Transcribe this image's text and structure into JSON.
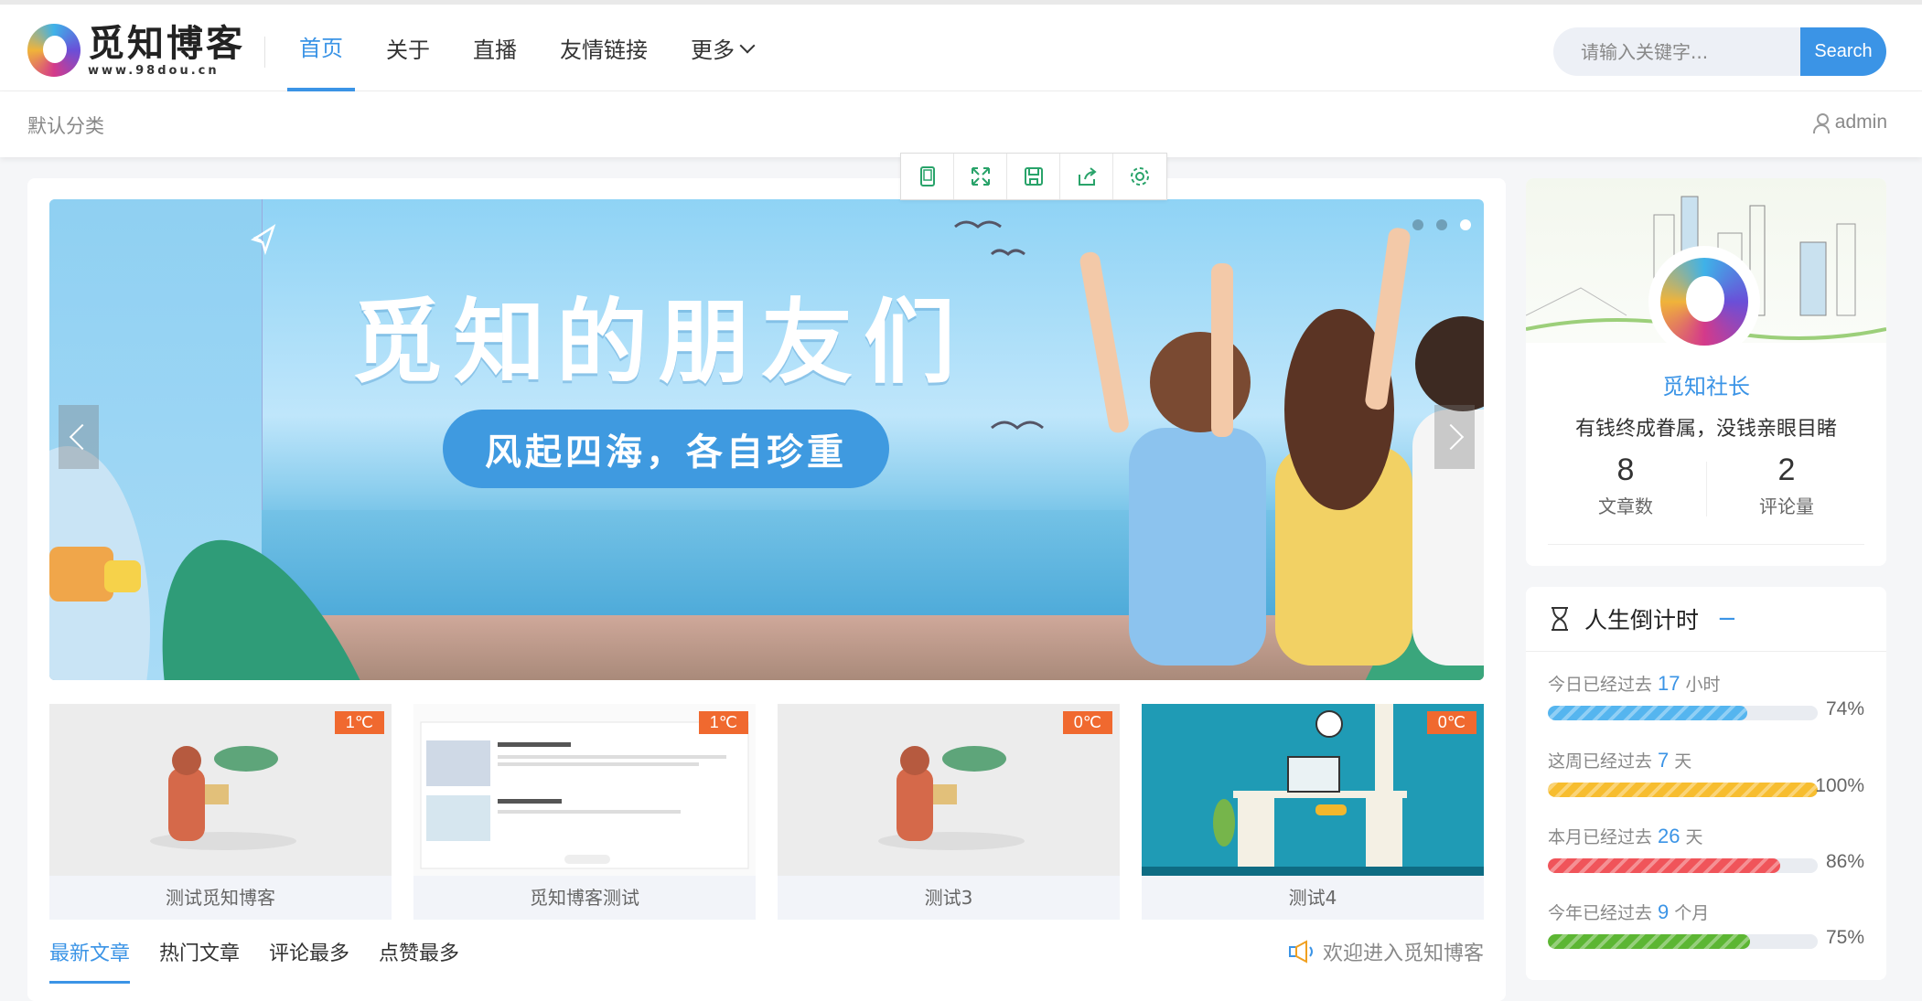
{
  "brand": {
    "title": "觅知博客",
    "subtitle": "www.98dou.cn"
  },
  "nav": {
    "items": [
      {
        "label": "首页",
        "active": true
      },
      {
        "label": "关于"
      },
      {
        "label": "直播"
      },
      {
        "label": "友情链接"
      },
      {
        "label": "更多"
      }
    ]
  },
  "search": {
    "placeholder": "请输入关键字...",
    "button": "Search"
  },
  "subbar": {
    "category": "默认分类",
    "user": "admin"
  },
  "toolbar": [
    "tablet-icon",
    "fullscreen-icon",
    "save-icon",
    "share-icon",
    "gear-icon"
  ],
  "banner": {
    "title": "觅知的朋友们",
    "slogan": "风起四海，各自珍重",
    "slides": 3,
    "active_slide": 3
  },
  "thumbs": [
    {
      "label": "测试觅知博客",
      "badge": "1℃"
    },
    {
      "label": "觅知博客测试",
      "badge": "1℃"
    },
    {
      "label": "测试3",
      "badge": "0℃"
    },
    {
      "label": "测试4",
      "badge": "0℃"
    }
  ],
  "tabs": [
    {
      "label": "最新文章",
      "active": true
    },
    {
      "label": "热门文章"
    },
    {
      "label": "评论最多"
    },
    {
      "label": "点赞最多"
    }
  ],
  "welcome": "欢迎进入觅知博客",
  "profile": {
    "name": "觅知社长",
    "motto": "有钱终成眷属，没钱亲眼目睹",
    "stats": [
      {
        "value": "8",
        "label": "文章数"
      },
      {
        "value": "2",
        "label": "评论量"
      }
    ]
  },
  "countdown": {
    "title": "人生倒计时",
    "toggle": "−",
    "rows": [
      {
        "prefix": "今日已经过去",
        "value": "17",
        "unit": "小时",
        "percent": "74%",
        "fraction": 0.74,
        "color": "#55b5ef"
      },
      {
        "prefix": "这周已经过去",
        "value": "7",
        "unit": "天",
        "percent": "100%",
        "fraction": 1.0,
        "color": "#f7bd2f"
      },
      {
        "prefix": "本月已经过去",
        "value": "26",
        "unit": "天",
        "percent": "86%",
        "fraction": 0.86,
        "color": "#f0545a"
      },
      {
        "prefix": "今年已经过去",
        "value": "9",
        "unit": "个月",
        "percent": "75%",
        "fraction": 0.75,
        "color": "#5cb633"
      }
    ]
  },
  "colors": {
    "accent": "#3b94e6",
    "badge": "#f0692f"
  }
}
